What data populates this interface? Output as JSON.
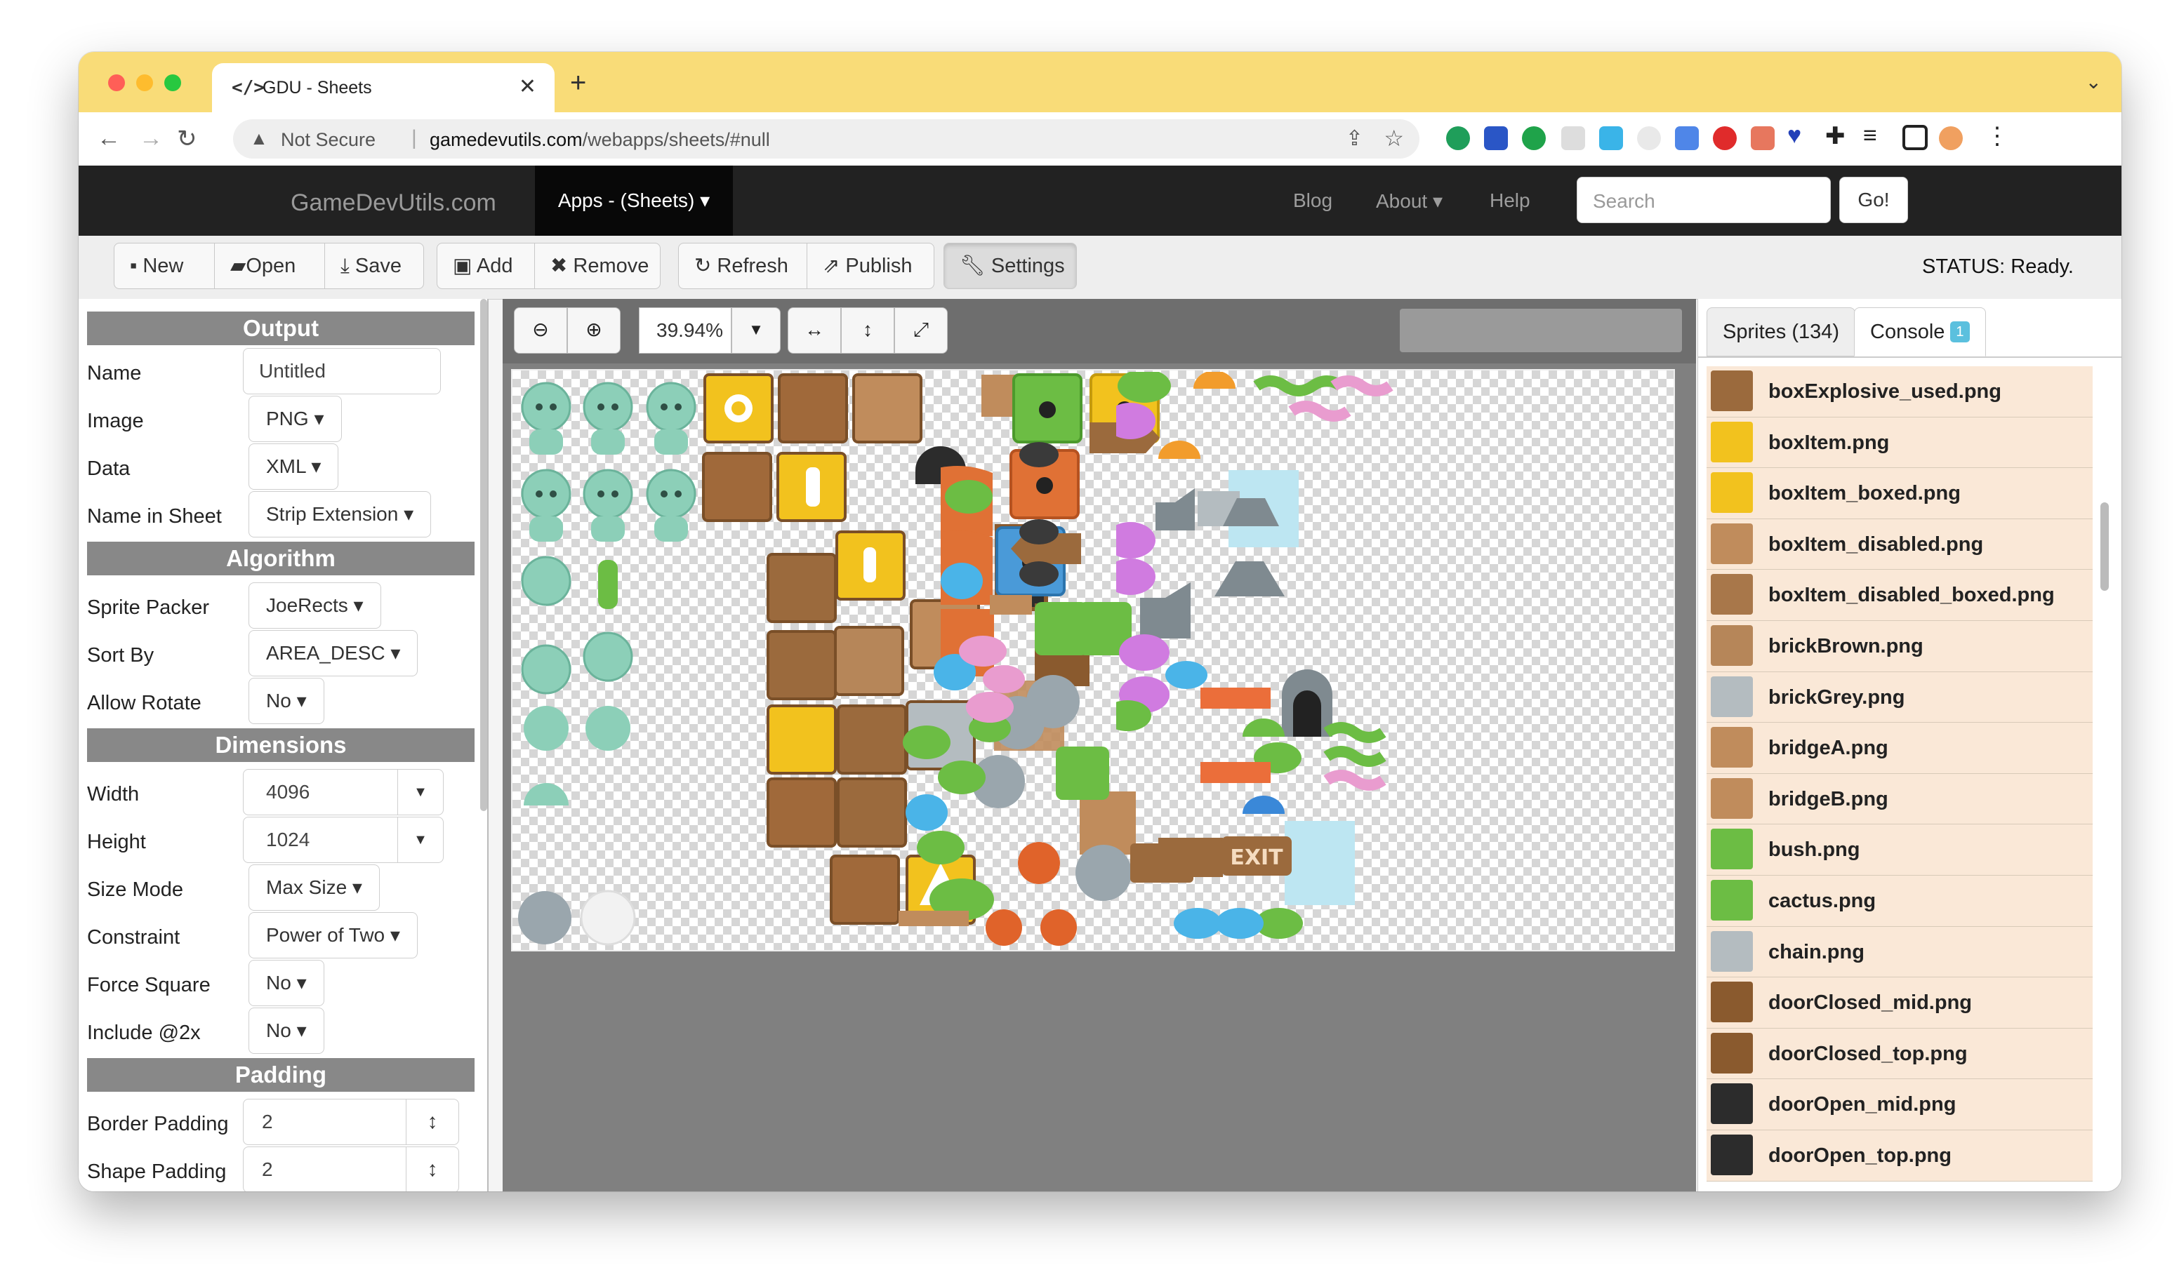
{
  "browser": {
    "tab_title": "GDU - Sheets",
    "tab_icon": "</>",
    "security_label": "Not Secure",
    "url_domain": "gamedevutils.com",
    "url_path": "/webapps/sheets/#null"
  },
  "site": {
    "brand": "GameDevUtils.com",
    "apps_menu": "Apps - (Sheets)",
    "nav": [
      "Blog",
      "About",
      "Help"
    ],
    "search_placeholder": "Search",
    "go_label": "Go!"
  },
  "toolbar": {
    "buttons": [
      "New",
      "Open",
      "Save",
      "Add",
      "Remove",
      "Refresh",
      "Publish",
      "Settings"
    ],
    "status": "STATUS: Ready."
  },
  "settings": {
    "output": {
      "title": "Output",
      "name_label": "Name",
      "name_value": "Untitled",
      "image_label": "Image",
      "image_value": "PNG",
      "data_label": "Data",
      "data_value": "XML",
      "name_in_sheet_label": "Name in Sheet",
      "name_in_sheet_value": "Strip Extension"
    },
    "algorithm": {
      "title": "Algorithm",
      "sprite_packer_label": "Sprite Packer",
      "sprite_packer_value": "JoeRects",
      "sort_by_label": "Sort By",
      "sort_by_value": "AREA_DESC",
      "allow_rotate_label": "Allow Rotate",
      "allow_rotate_value": "No"
    },
    "dimensions": {
      "title": "Dimensions",
      "width_label": "Width",
      "width_value": "4096",
      "height_label": "Height",
      "height_value": "1024",
      "size_mode_label": "Size Mode",
      "size_mode_value": "Max Size",
      "constraint_label": "Constraint",
      "constraint_value": "Power of Two",
      "force_square_label": "Force Square",
      "force_square_value": "No",
      "include2x_label": "Include @2x",
      "include2x_value": "No"
    },
    "padding": {
      "title": "Padding",
      "border_padding_label": "Border Padding",
      "border_padding_value": "2",
      "shape_padding_label": "Shape Padding",
      "shape_padding_value": "2"
    }
  },
  "canvas": {
    "zoom": "39.94%"
  },
  "sprites_panel": {
    "tab_sprites": "Sprites (134)",
    "tab_console": "Console",
    "console_badge": "1",
    "items": [
      {
        "name": "boxExplosive_used.png",
        "thumb": "#9b6a3d"
      },
      {
        "name": "boxItem.png",
        "thumb": "#f2c21e"
      },
      {
        "name": "boxItem_boxed.png",
        "thumb": "#f2c21e"
      },
      {
        "name": "boxItem_disabled.png",
        "thumb": "#c08c5c"
      },
      {
        "name": "boxItem_disabled_boxed.png",
        "thumb": "#a8774a"
      },
      {
        "name": "brickBrown.png",
        "thumb": "#b68659"
      },
      {
        "name": "brickGrey.png",
        "thumb": "#b4bcc0"
      },
      {
        "name": "bridgeA.png",
        "thumb": "#c08c5c"
      },
      {
        "name": "bridgeB.png",
        "thumb": "#c08c5c"
      },
      {
        "name": "bush.png",
        "thumb": "#6cbd44"
      },
      {
        "name": "cactus.png",
        "thumb": "#6cbd44"
      },
      {
        "name": "chain.png",
        "thumb": "#b4bcc0"
      },
      {
        "name": "doorClosed_mid.png",
        "thumb": "#8a5a2e"
      },
      {
        "name": "doorClosed_top.png",
        "thumb": "#8a5a2e"
      },
      {
        "name": "doorOpen_mid.png",
        "thumb": "#2c2c2c"
      },
      {
        "name": "doorOpen_top.png",
        "thumb": "#2c2c2c"
      }
    ]
  }
}
